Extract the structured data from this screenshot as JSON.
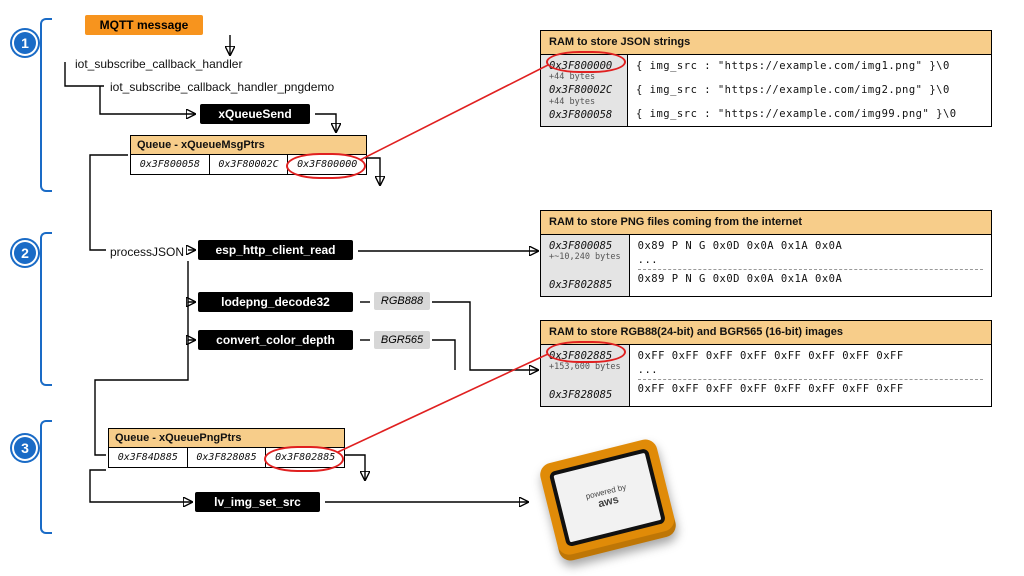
{
  "labels": {
    "mqtt": "MQTT message",
    "cb1": "iot_subscribe_callback_handler",
    "cb2": "iot_subscribe_callback_handler_pngdemo",
    "xqsend": "xQueueSend",
    "processJSON": "processJSON",
    "http_read": "esp_http_client_read",
    "lodepng": "lodepng_decode32",
    "convert": "convert_color_depth",
    "lv_img": "lv_img_set_src",
    "rgb888": "RGB888",
    "bgr565": "BGR565"
  },
  "queues": {
    "msg": {
      "title": "Queue - xQueueMsgPtrs",
      "cells": [
        "0x3F800058",
        "0x3F80002C",
        "0x3F800000"
      ]
    },
    "png": {
      "title": "Queue - xQueuePngPtrs",
      "cells": [
        "0x3F84D885",
        "0x3F828085",
        "0x3F802885"
      ]
    }
  },
  "ram": {
    "json": {
      "title": "RAM to store JSON strings",
      "addrs": [
        "0x3F800000",
        "0x3F80002C",
        "0x3F800058"
      ],
      "addrNotes": [
        "+44 bytes",
        "+44 bytes",
        ""
      ],
      "data": [
        "{ img_src : \"https://example.com/img1.png\" }\\0",
        "{ img_src : \"https://example.com/img2.png\" }\\0",
        "{ img_src : \"https://example.com/img99.png\" }\\0"
      ]
    },
    "png": {
      "title": "RAM to store PNG files coming from the internet",
      "addrs": [
        "0x3F800085",
        "0x3F802885"
      ],
      "addrNotes": [
        "+~10,240 bytes",
        ""
      ],
      "data": [
        "0x89  P    N    G     0x0D  0x0A  0x1A  0x0A",
        "0x89  P    N    G     0x0D  0x0A  0x1A  0x0A"
      ],
      "ellipsis": "..."
    },
    "rgb": {
      "title": "RAM to store RGB88(24-bit) and BGR565 (16-bit) images",
      "addrs": [
        "0x3F802885",
        "0x3F828085"
      ],
      "addrNotes": [
        "+153,600 bytes",
        ""
      ],
      "data": [
        "0xFF  0xFF  0xFF  0xFF  0xFF  0xFF  0xFF  0xFF",
        "0xFF  0xFF  0xFF  0xFF  0xFF  0xFF  0xFF  0xFF"
      ],
      "ellipsis": "..."
    }
  },
  "device": {
    "line1": "powered by",
    "line2": "aws"
  },
  "badges": [
    "1",
    "2",
    "3"
  ]
}
